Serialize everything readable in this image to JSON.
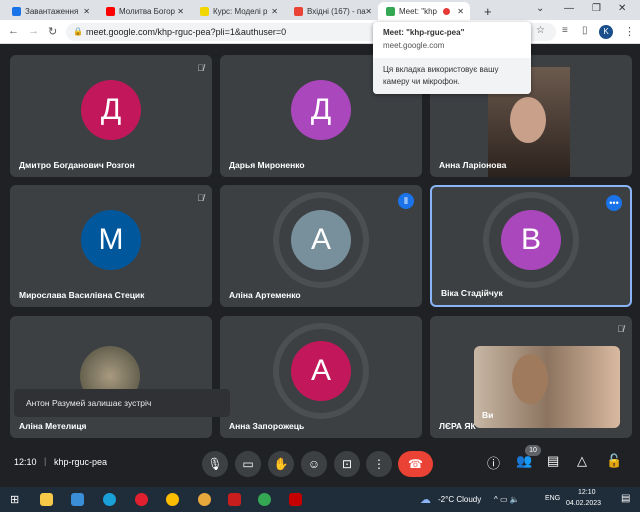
{
  "tabs": [
    {
      "label": "Завантаження",
      "color": "#1a73e8"
    },
    {
      "label": "Молитва Богор",
      "color": "#ff0000"
    },
    {
      "label": "Курс: Моделі р",
      "color": "#f2d600"
    },
    {
      "label": "Вхідні (167) - па",
      "color": "#ea4335"
    },
    {
      "label": "Meet: \"khp",
      "color": "#34a853",
      "active": true
    }
  ],
  "new_tab": "+",
  "url": "meet.google.com/khp-rguc-pea?pli=1&authuser=0",
  "profile_initial": "K",
  "popup": {
    "title": "Meet: \"khp-rguc-pea\"",
    "domain": "meet.google.com",
    "message": "Ця вкладка використовує вашу камеру чи мікрофон."
  },
  "tiles": [
    {
      "name": "Дмитро Богданович Розгон",
      "initial": "Д",
      "color": "#c2185b",
      "muted": true
    },
    {
      "name": "Дарья Мироненко",
      "initial": "Д",
      "color": "#ab47bc"
    },
    {
      "name": "Анна Ларіонова",
      "video": true
    },
    {
      "name": "Мирослава Василівна Стецик",
      "initial": "М",
      "color": "#01579b",
      "muted": true
    },
    {
      "name": "Аліна Артеменко",
      "initial": "А",
      "color": "#78909c",
      "speaking": true
    },
    {
      "name": "Віка Стадійчук",
      "initial": "В",
      "color": "#ab47bc",
      "pinned": true
    },
    {
      "name": "Аліна Метелиця",
      "video": true
    },
    {
      "name": "Анна Запорожець",
      "initial": "А",
      "color": "#c2185b"
    },
    {
      "name": "ЛЄРА ЯК",
      "muted": true,
      "self_label": "Ви"
    }
  ],
  "toast": "Антон Разумей залишає зустріч",
  "bottom": {
    "time": "12:10",
    "meeting_code": "khp-rguc-pea",
    "participants_count": "10"
  },
  "taskbar": {
    "weather": "-2°C  Cloudy",
    "lang": "ENG",
    "time": "12:10",
    "date": "04.02.2023"
  }
}
